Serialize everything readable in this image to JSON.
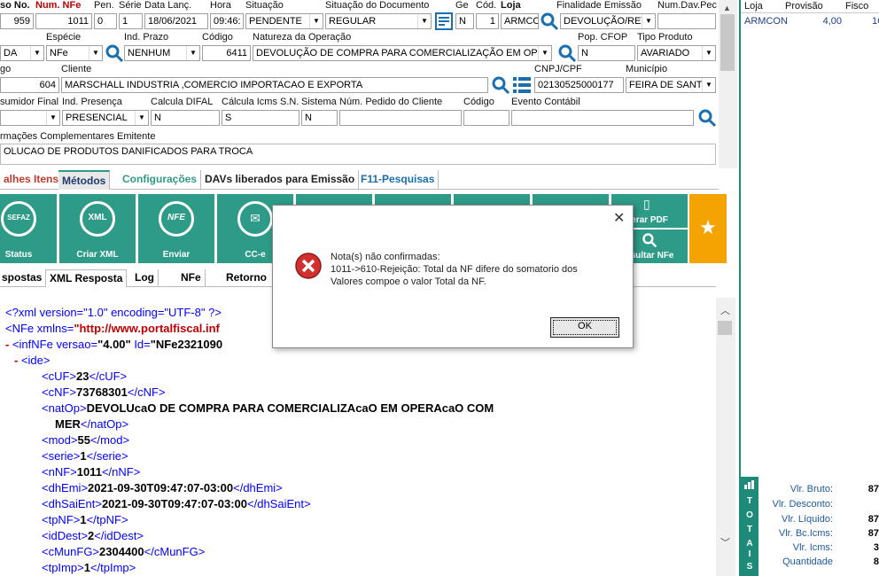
{
  "header_row1": {
    "labels": [
      "so No.",
      "Num. NFe",
      "Pen.",
      "Série",
      "Data Lanç.",
      "Hora",
      "Situação",
      "Situação do Documento",
      "Ge",
      "Cód.",
      "Loja",
      "Finalidade Emissão",
      "Num.Dav.Pec"
    ],
    "pedido_no": "959",
    "num_nfe": "1011",
    "pen": "0",
    "serie": "1",
    "data_lanc": "18/06/2021",
    "hora": "09:46:",
    "situacao": "PENDENTE",
    "situacao_doc": "REGULAR",
    "ge": "N",
    "cod": "1",
    "loja": "ARMCO",
    "finalidade": "DEVOLUÇÃO/RET",
    "num_dav": ""
  },
  "header_row2": {
    "labels": [
      "Espécie",
      "Ind. Prazo",
      "Código",
      "Natureza da Operação",
      "Pop. CFOP",
      "Tipo Produto"
    ],
    "col1": "DA",
    "especie": "NFe",
    "ind_prazo": "NENHUM",
    "codigo": "6411",
    "natureza": "DEVOLUÇÃO DE COMPRA PARA COMERCIALIZAÇÃO EM OPERA",
    "pop_cfop": "N",
    "tipo_produto": "AVARIADO"
  },
  "header_row3": {
    "labels": [
      "go",
      "Cliente",
      "CNPJ/CPF",
      "Município"
    ],
    "cli_cod": "604",
    "cliente": "MARSCHALL INDUSTRIA ,COMERCIO IMPORTACAO E EXPORTA",
    "cnpj": "02130525000177",
    "municipio": "FEIRA DE SANT"
  },
  "header_row4": {
    "labels": [
      "sumidor Final",
      "Ind. Presença",
      "Calcula DIFAL",
      "Cálcula Icms S.N.",
      "Sistema",
      "Núm. Pedido do Cliente",
      "Código",
      "Evento Contábil"
    ],
    "ind_presenca": "PRESENCIAL",
    "calc_difal": "N",
    "calc_icms": "S",
    "sistema": "N",
    "num_pedido": "",
    "codigo": "",
    "evento": ""
  },
  "info_comp": {
    "label": "rmações Complementares Emitente",
    "value": "OLUCAO DE PRODUTOS DANIFICADOS PARA TROCA"
  },
  "tabs": [
    "alhes Itens",
    "Métodos",
    "Configurações",
    "DAVs liberados para Emissão",
    "F11-Pesquisas"
  ],
  "toolbar": {
    "status": "Status",
    "criar_xml": "Criar XML",
    "enviar": "Enviar",
    "cce": "CC-e",
    "gerar_pdf": "erar PDF",
    "consultar_nfe": "nsultar NFe",
    "sefaz": "SEFAZ",
    "xml": "XML",
    "nfe": "NFE"
  },
  "subtabs": [
    "spostas",
    "XML Resposta",
    "Log",
    "NFe",
    "Retorno"
  ],
  "xml": {
    "l1": "<?xml version=\"1.0\" encoding=\"UTF-8\" ?>",
    "l2a": "<NFe xmlns=",
    "l2b": "\"http://www.portalfiscal.inf",
    "l3a": "<infNFe versao=",
    "l3b": "\"4.00\"",
    "l3c": " Id=",
    "l3d": "\"NFe2321090",
    "ide": "<ide>",
    "cUF": "23",
    "cNF": "73768301",
    "natOp1": "DEVOLUcaO DE COMPRA PARA COMERCIALIZAcaO EM OPERAcaO COM",
    "natOp2": "MER",
    "mod": "55",
    "serie": "1",
    "nNF": "1011",
    "dhEmi": "2021-09-30T09:47:07-03:00",
    "dhSaiEnt": "2021-09-30T09:47:07-03:00",
    "tpNF": "1",
    "idDest": "2",
    "cMunFG": "2304400",
    "tpImp": "1"
  },
  "dialog": {
    "msg1": "Nota(s) não confirmadas:",
    "msg2": "1011->610-Rejeição: Total da NF difere do somatorio dos",
    "msg3": "Valores compoe o valor Total da NF.",
    "ok": "OK"
  },
  "right": {
    "headers": [
      "Loja",
      "Provisão",
      "Fisco"
    ],
    "row": [
      "ARMCON",
      "4,00",
      "1C"
    ]
  },
  "totals": {
    "side": [
      "T",
      "O",
      "T",
      "A",
      "I",
      "S"
    ],
    "rows": [
      [
        "Vlr. Bruto:",
        "87"
      ],
      [
        "Vlr. Desconto:",
        ""
      ],
      [
        "Vlr. Líquido:",
        "87"
      ],
      [
        "Vlr. Bc.Icms:",
        "87"
      ],
      [
        "Vlr. Icms:",
        "3"
      ],
      [
        "Quantidade",
        "8"
      ]
    ]
  },
  "colors": {
    "teal": "#2d9b87",
    "orange": "#f4a300",
    "red": "#c00000"
  }
}
